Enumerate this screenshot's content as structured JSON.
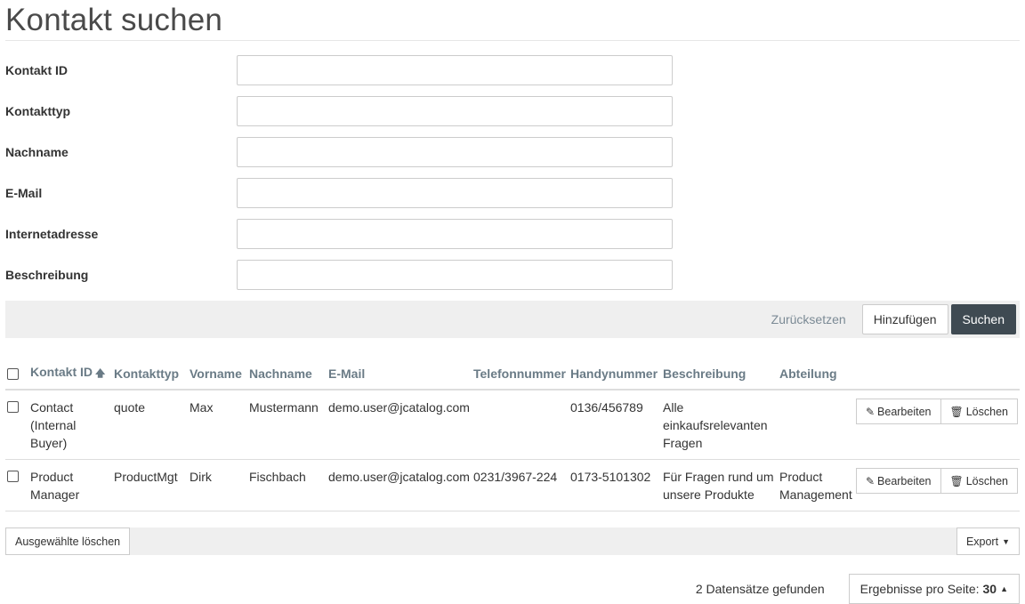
{
  "page": {
    "title": "Kontakt suchen"
  },
  "form": {
    "fields": [
      {
        "label": "Kontakt ID",
        "value": ""
      },
      {
        "label": "Kontakttyp",
        "value": ""
      },
      {
        "label": "Nachname",
        "value": ""
      },
      {
        "label": "E-Mail",
        "value": ""
      },
      {
        "label": "Internetadresse",
        "value": ""
      },
      {
        "label": "Beschreibung",
        "value": ""
      }
    ]
  },
  "actions": {
    "reset": "Zurücksetzen",
    "add": "Hinzufügen",
    "search": "Suchen"
  },
  "table": {
    "columns": [
      "Kontakt ID",
      "Kontakttyp",
      "Vorname",
      "Nachname",
      "E-Mail",
      "Telefonnummer",
      "Handynummer",
      "Beschreibung",
      "Abteilung"
    ],
    "sort_icon": "arrow-up-icon",
    "rows": [
      {
        "kontakt_id": "Contact (Internal Buyer)",
        "kontakttyp": "quote",
        "vorname": "Max",
        "nachname": "Mustermann",
        "email": "demo.user@jcatalog.com",
        "telefon": "",
        "handy": "0136/456789",
        "beschreibung": "Alle einkaufsrelevanten Fragen",
        "abteilung": ""
      },
      {
        "kontakt_id": "Product Manager",
        "kontakttyp": "ProductMgt",
        "vorname": "Dirk",
        "nachname": "Fischbach",
        "email": "demo.user@jcatalog.com",
        "telefon": "0231/3967-224",
        "handy": "0173-5101302",
        "beschreibung": "Für Fragen rund um unsere Produkte",
        "abteilung": "Product Management"
      }
    ],
    "row_actions": {
      "edit": "Bearbeiten",
      "delete": "Löschen"
    }
  },
  "bulk": {
    "delete_selected": "Ausgewählte löschen",
    "export": "Export"
  },
  "footer": {
    "count": "2 Datensätze gefunden",
    "per_page_label": "Ergebnisse pro Seite:",
    "per_page_value": "30"
  },
  "colors": {
    "primary": "#3f4a52",
    "header_text": "#6a7b86",
    "bar_bg": "#efefef"
  }
}
